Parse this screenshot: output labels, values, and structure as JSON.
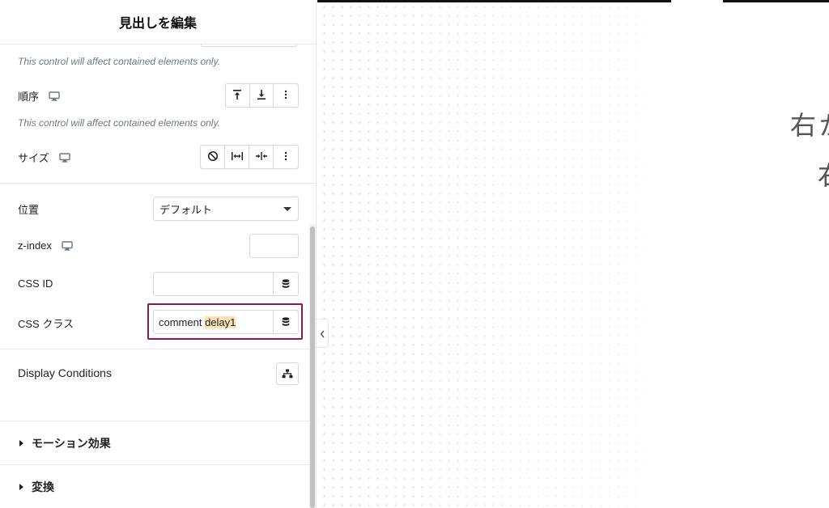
{
  "panel": {
    "title": "見出しを編集",
    "notes": {
      "order_note": "This control will affect contained elements only.",
      "size_note": "This control will affect contained elements only."
    },
    "order": {
      "label": "順序"
    },
    "size": {
      "label": "サイズ"
    },
    "position": {
      "label": "位置",
      "value": "デフォルト"
    },
    "zindex": {
      "label": "z-index",
      "value": ""
    },
    "css_id": {
      "label": "CSS ID",
      "value": ""
    },
    "css_class": {
      "label": "CSS クラス",
      "value_plain": "comment ",
      "value_highlight": "delay1"
    },
    "display_conditions": {
      "label": "Display Conditions"
    },
    "sections": [
      {
        "label": "モーション効果"
      },
      {
        "label": "変換"
      }
    ]
  },
  "canvas": {
    "heading_line1": "右が",
    "heading_line2": "右"
  },
  "colors": {
    "highlight_border": "#8b1a4f",
    "text_highlight": "#fbe3b4"
  },
  "icons": [
    "desktop-icon",
    "align-top-icon",
    "align-bottom-icon",
    "more-vertical-icon",
    "no-icon",
    "full-width-icon",
    "inline-width-icon",
    "database-icon",
    "sitemap-icon",
    "chevron-left-icon"
  ]
}
